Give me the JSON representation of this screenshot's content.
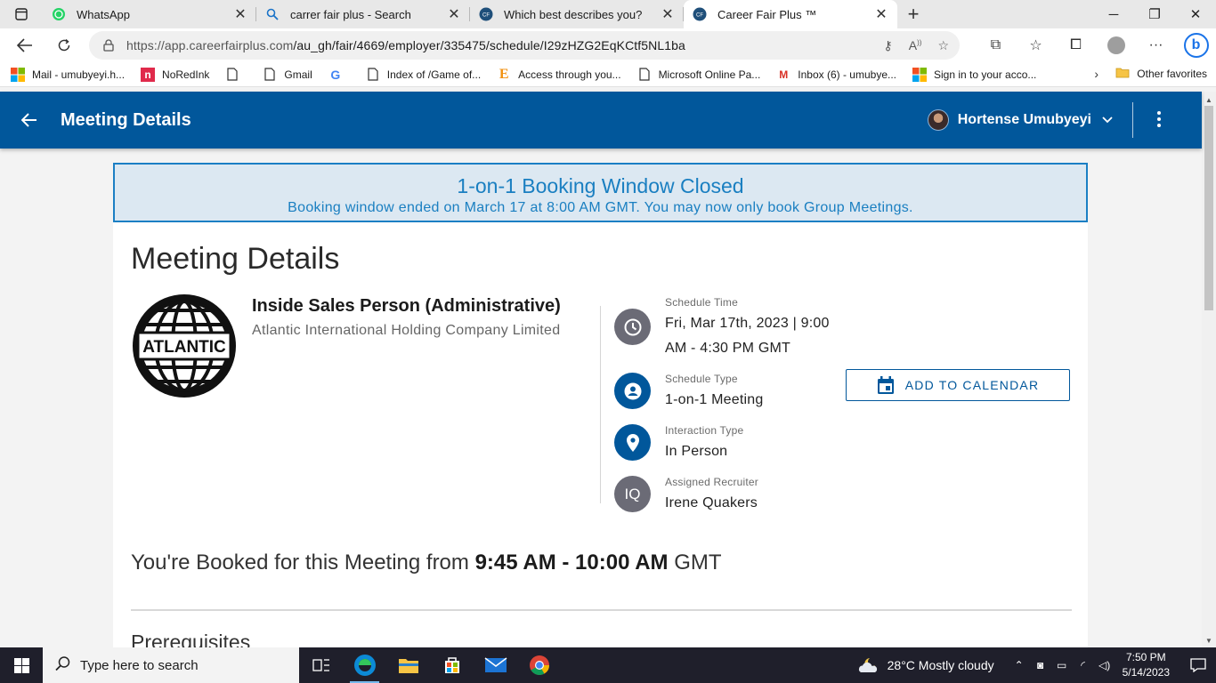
{
  "browser": {
    "tabs": [
      {
        "title": "WhatsApp",
        "icon": "whatsapp-icon"
      },
      {
        "title": "carrer fair plus - Search",
        "icon": "search-icon"
      },
      {
        "title": "Which best describes you?",
        "icon": "careerfairplus-icon"
      },
      {
        "title": "Career Fair Plus ™",
        "icon": "careerfairplus-icon"
      }
    ],
    "url_host": "https://app.careerfairplus.com",
    "url_path": "/au_gh/fair/4669/employer/335475/schedule/I29zHZG2EqKCtf5NL1ba",
    "favorites": [
      {
        "label": "Mail - umubyeyi.h...",
        "icon": "microsoft-icon"
      },
      {
        "label": "NoRedInk",
        "icon": "noredink-icon"
      },
      {
        "label": "",
        "icon": "page-icon"
      },
      {
        "label": "Gmail",
        "icon": "page-icon"
      },
      {
        "label": "",
        "icon": "google-icon"
      },
      {
        "label": "Index of /Game of...",
        "icon": "page-icon"
      },
      {
        "label": "Access through you...",
        "icon": "e-icon"
      },
      {
        "label": "Microsoft Online Pa...",
        "icon": "page-icon"
      },
      {
        "label": "Inbox (6) - umubye...",
        "icon": "gmail-icon"
      },
      {
        "label": "Sign in to your acco...",
        "icon": "microsoft-icon"
      }
    ],
    "other_favorites": "Other favorites"
  },
  "header": {
    "title": "Meeting Details",
    "user_name": "Hortense Umubyeyi"
  },
  "banner": {
    "heading": "1-on-1 Booking Window Closed",
    "text": "Booking window ended on March 17 at 8:00 AM GMT. You may now only book Group Meetings."
  },
  "meeting": {
    "page_title": "Meeting Details",
    "logo_text": "ATLANTIC",
    "job_title": "Inside Sales Person (Administrative)",
    "company": "Atlantic International Holding Company Limited",
    "schedule_time_label": "Schedule Time",
    "schedule_time_line1": "Fri, Mar 17th, 2023 | 9:00",
    "schedule_time_line2": "AM - 4:30 PM GMT",
    "schedule_type_label": "Schedule Type",
    "schedule_type": "1-on-1 Meeting",
    "interaction_type_label": "Interaction Type",
    "interaction_type": "In Person",
    "recruiter_label": "Assigned Recruiter",
    "recruiter_initials": "IQ",
    "recruiter": "Irene Quakers",
    "add_to_calendar": "ADD TO CALENDAR",
    "booked_prefix": "You're Booked for this Meeting from ",
    "booked_time": "9:45 AM - 10:00 AM",
    "booked_suffix": " GMT",
    "prerequisites": "Prerequisites"
  },
  "taskbar": {
    "search_placeholder": "Type here to search",
    "weather": "28°C  Mostly cloudy",
    "time": "7:50 PM",
    "date": "5/14/2023"
  },
  "colors": {
    "header_blue": "#01579b",
    "banner_blue": "#1a7fc1",
    "icon_circle_blue": "#01579b",
    "icon_circle_gray": "#6b6b76"
  }
}
